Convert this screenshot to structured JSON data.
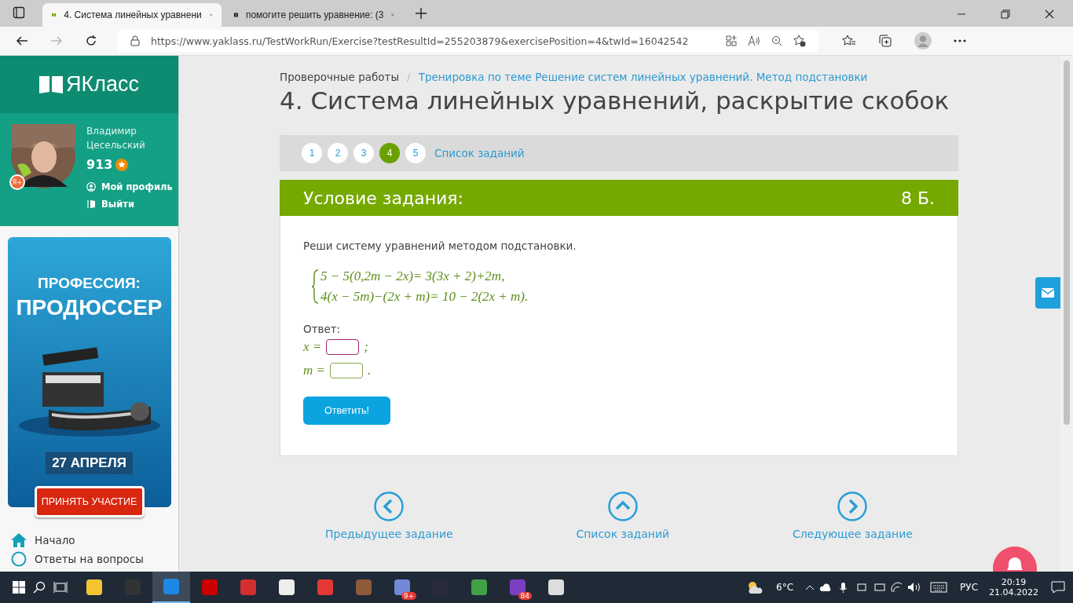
{
  "browser": {
    "tabs": [
      {
        "title": "4. Система линейных уравнени",
        "selected": true
      },
      {
        "title": "помогите решить уравнение: (3",
        "selected": false
      }
    ],
    "url": "https://www.yaklass.ru/TestWorkRun/Exercise?testResultId=255203879&exercisePosition=4&twId=16042542"
  },
  "sidebar": {
    "logo": "ЯКласс",
    "user": {
      "name": "Владимир Цесельский",
      "points": "913",
      "badge": "Я+",
      "links": [
        "Мой профиль",
        "Выйти"
      ]
    },
    "ad": {
      "line1": "ПРОФЕССИЯ:",
      "line2": "ПРОДЮССЕР",
      "date": "27 АПРЕЛЯ",
      "button": "ПРИНЯТЬ УЧАСТИЕ"
    },
    "nav": [
      "Начало",
      "Ответы на вопросы"
    ]
  },
  "breadcrumb_separator": "/",
  "breadcrumb": [
    "Проверочные работы",
    "Тренировка по теме Решение систем линейных уравнений. Метод подстановки"
  ],
  "title": "4. Система линейных уравнений, раскрытие скобок",
  "pages": [
    {
      "label": "1",
      "selected": false
    },
    {
      "label": "2",
      "selected": false
    },
    {
      "label": "3",
      "selected": false
    },
    {
      "label": "4",
      "selected": true
    },
    {
      "label": "5",
      "selected": false
    }
  ],
  "task_list_link": "Список заданий",
  "task": {
    "heading": "Условие задания:",
    "score": "8 Б.",
    "prompt": "Реши систему уравнений методом подстановки.",
    "equations": [
      "5 − 5(0,2m − 2x)= 3(3x + 2)+2m,",
      "4(x − 5m)−(2x + m)= 10 − 2(2x + m)."
    ],
    "answer_label": "Ответ:",
    "answers": [
      {
        "variable": "x =",
        "end": ";",
        "focused": true
      },
      {
        "variable": "m =",
        "end": ".",
        "focused": false
      }
    ],
    "submit": "Ответить!"
  },
  "footer_nav": [
    {
      "label": "Предыдущее задание",
      "kind": "prev"
    },
    {
      "label": "Список заданий",
      "kind": "up"
    },
    {
      "label": "Следующее задание",
      "kind": "next"
    }
  ],
  "taskbar": {
    "apps": [
      {
        "selected": false
      },
      {
        "selected": false
      },
      {
        "selected": true
      },
      {
        "selected": false
      },
      {
        "selected": false
      },
      {
        "selected": false
      },
      {
        "selected": false
      },
      {
        "selected": false
      },
      {
        "selected": false,
        "badge": "9+"
      },
      {
        "selected": false
      },
      {
        "selected": false
      },
      {
        "selected": false,
        "badge": "84"
      },
      {
        "selected": false
      }
    ],
    "weather": "6°C",
    "lang": "РУС",
    "time": "20:19",
    "date": "21.04.2022"
  }
}
